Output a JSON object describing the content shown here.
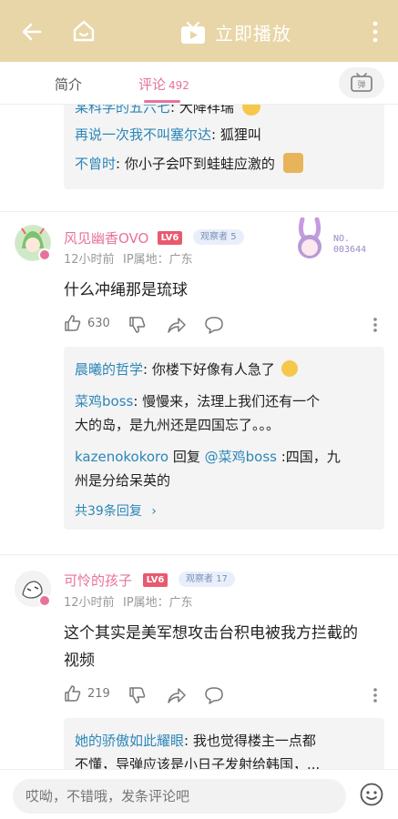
{
  "header": {
    "play_label": "立即播放"
  },
  "tabs": {
    "intro": "简介",
    "comments": "评论",
    "comments_count": "492"
  },
  "top_replies": [
    {
      "user": "某科学的五六七",
      "text": ": 大降祥瑞"
    },
    {
      "user": "再说一次我不叫塞尔达",
      "text": ": 狐狸叫"
    },
    {
      "user": "不曾时",
      "text": ": 你小子会吓到蛙蛙应激的"
    }
  ],
  "comment1": {
    "user": "风见幽香OVO",
    "level": "LV6",
    "badge": "观察者",
    "badge_level": "5",
    "time": "12小时前",
    "ip": "IP属地：广东",
    "fan_id": "NO.\n003644",
    "text": "什么冲绳那是琉球",
    "likes": "630",
    "replies": [
      {
        "user": "晨曦的哲学",
        "text": ": 你楼下好像有人急了"
      },
      {
        "user": "菜鸡boss",
        "text": ": 慢慢来，法理上我们还有一个",
        "text2": "大的岛，是九州还是四国忘了。。。"
      },
      {
        "user": "kazenokokoro",
        "mid": " 回复 ",
        "at": "@菜鸡boss",
        "text": " :四国，九",
        "text2": "州是分给呆英的"
      }
    ],
    "more_replies": "共39条回复"
  },
  "comment2": {
    "user": "可怜的孩子",
    "level": "LV6",
    "badge": "观察者",
    "badge_level": "17",
    "time": "12小时前",
    "ip": "IP属地：广东",
    "text_line1": "这个其实是美军想攻击台积电被我方拦截的",
    "text_line2": "视频",
    "likes": "219",
    "replies": [
      {
        "user": "她的骄傲如此耀眼",
        "text": ": 我也觉得楼主一点都",
        "text2": "不懂，导弹应该是小日子发射给韩国，..."
      }
    ]
  },
  "input": {
    "placeholder": "哎呦，不错哦，发条评论吧"
  },
  "colors": {
    "header_bg": "#e8d6a8",
    "accent_pink": "#e8729a",
    "link_blue": "#2b86b8",
    "level_red": "#e85a6e"
  }
}
